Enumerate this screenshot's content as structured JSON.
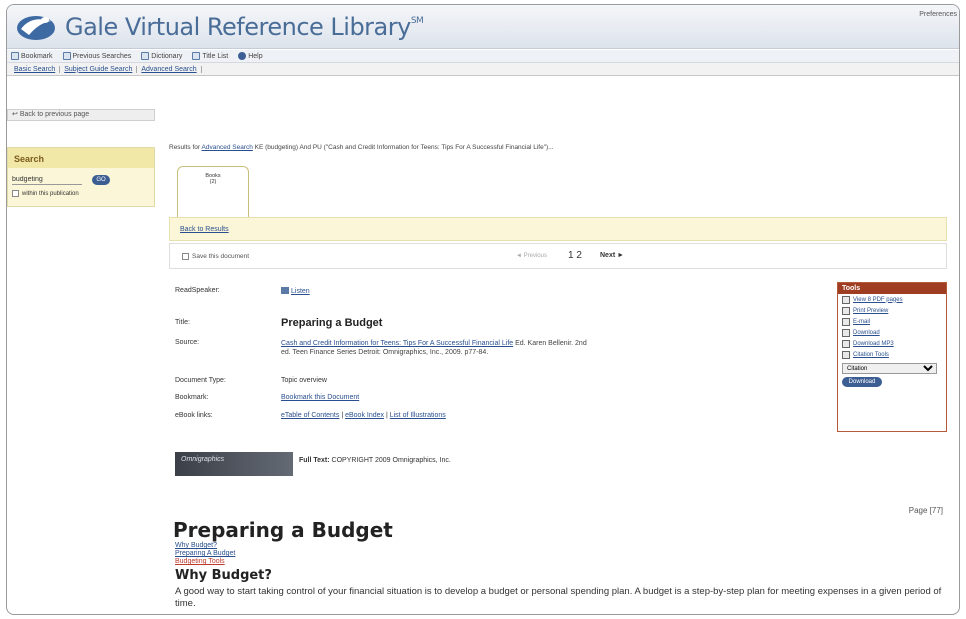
{
  "header": {
    "title": "Gale Virtual Reference Library",
    "trademark": "SM",
    "top_right": "Preferences"
  },
  "toolbar": {
    "items": [
      "Bookmark",
      "Previous Searches",
      "Dictionary",
      "Title List",
      "Help"
    ]
  },
  "search_tabs": [
    "Basic Search",
    "Subject Guide Search",
    "Advanced Search"
  ],
  "sidebar": {
    "back_link": "Back to previous page",
    "search_heading": "Search",
    "search_value": "budgeting",
    "go_label": "GO",
    "within_label": "within this publication"
  },
  "results": {
    "prefix": "Results for",
    "link": "Advanced Search",
    "query": "KE (budgeting) And PU (\"Cash and Credit Information for Teens: Tips For A Successful Financial Life\")..."
  },
  "books_tab": {
    "label": "Books",
    "count": "(2)"
  },
  "back_to_results": "Back to Results",
  "nav": {
    "save_label": "Save this document",
    "prev_label": "◄ Previous",
    "pages": "1 2",
    "next_label": "Next ►"
  },
  "meta": {
    "readspeaker_label": "ReadSpeaker:",
    "listen": "Listen",
    "title_label": "Title:",
    "title_value": "Preparing a Budget",
    "source_label": "Source:",
    "source_link": "Cash and Credit Information for Teens: Tips For A Successful Financial Life",
    "source_rest": "Ed. Karen Bellenir. 2nd",
    "source_line2": "ed. Teen Finance Series Detroit: Omnigraphics, Inc., 2009. p77-84.",
    "doctype_label": "Document Type:",
    "doctype_value": "Topic overview",
    "bookmark_label": "Bookmark:",
    "bookmark_value": "Bookmark this Document",
    "ebook_label": "eBook links:",
    "ebook_links": [
      "eTable of Contents",
      "eBook Index",
      "List of Illustrations"
    ]
  },
  "tools": {
    "heading": "Tools",
    "items": [
      "View 8 PDF pages",
      "Print Preview",
      "E-mail",
      "Download",
      "Download MP3",
      "Citation Tools"
    ],
    "select_value": "Citation",
    "button": "Download"
  },
  "publisher_banner": "Omnigraphics",
  "fulltext": {
    "label": "Full Text:",
    "value": "COPYRIGHT 2009 Omnigraphics, Inc."
  },
  "page_number": "Page [77]",
  "article": {
    "title": "Preparing a Budget",
    "toc": [
      "Why Budget?",
      "Preparing A Budget",
      "Budgeting Tools"
    ],
    "section": "Why Budget?",
    "body": "A good way to start taking control of your financial situation is to develop a budget or personal spending plan. A budget is a step-by-step plan for meeting expenses in a given period of time."
  }
}
